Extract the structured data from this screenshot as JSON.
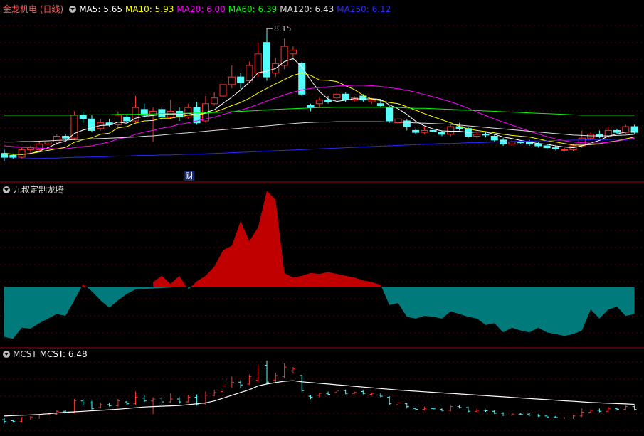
{
  "panel1": {
    "title": "金龙机电 (日线)",
    "ma_labels": [
      {
        "text": "MA5: 5.65",
        "color": "#ffffff"
      },
      {
        "text": "MA10: 5.93",
        "color": "#ffff00"
      },
      {
        "text": "MA20: 6.00",
        "color": "#ff00ff"
      },
      {
        "text": "MA60: 6.39",
        "color": "#00ff00"
      },
      {
        "text": "MA120: 6.43",
        "color": "#dddddd"
      },
      {
        "text": "MA250: 6.12",
        "color": "#2a2aff"
      }
    ],
    "high_label": "8.15",
    "event_badge": "财"
  },
  "panel2": {
    "title": "九叔定制龙腾"
  },
  "panel3": {
    "title": "MCST",
    "value_label": "MCST: 6.48"
  },
  "colors": {
    "up": "#ff3030",
    "down": "#54ffff",
    "grid": "#5a0000",
    "separator": "#a00000",
    "pos_area": "#c00000",
    "neg_area": "#007a7a",
    "mcst": "#ffffff"
  },
  "chart_data": [
    {
      "type": "candlestick",
      "panel": "price",
      "ylim": [
        4.4,
        8.6
      ],
      "candles": [
        [
          5.0,
          4.9,
          5.1,
          4.8
        ],
        [
          4.95,
          4.9,
          5.0,
          4.85
        ],
        [
          4.9,
          5.1,
          5.15,
          4.85
        ],
        [
          5.1,
          5.15,
          5.2,
          5.0
        ],
        [
          5.1,
          5.25,
          5.3,
          5.05
        ],
        [
          5.25,
          5.3,
          5.4,
          5.2
        ],
        [
          5.3,
          5.45,
          5.5,
          5.25
        ],
        [
          5.45,
          5.4,
          5.5,
          5.35
        ],
        [
          5.4,
          6.0,
          6.1,
          5.35
        ],
        [
          6.0,
          5.9,
          6.1,
          5.8
        ],
        [
          5.9,
          5.6,
          6.0,
          5.55
        ],
        [
          5.65,
          5.8,
          5.9,
          5.6
        ],
        [
          5.8,
          5.75,
          5.9,
          5.7
        ],
        [
          5.75,
          6.0,
          6.1,
          5.7
        ],
        [
          5.95,
          5.85,
          6.0,
          5.8
        ],
        [
          5.85,
          6.2,
          6.5,
          5.8
        ],
        [
          6.15,
          6.0,
          6.3,
          5.95
        ],
        [
          6.0,
          6.1,
          6.2,
          5.3
        ],
        [
          6.15,
          5.95,
          6.2,
          5.8
        ],
        [
          5.95,
          6.1,
          6.4,
          5.9
        ],
        [
          6.1,
          5.95,
          6.2,
          5.85
        ],
        [
          5.95,
          6.2,
          6.3,
          5.9
        ],
        [
          6.2,
          5.8,
          6.35,
          5.75
        ],
        [
          5.85,
          6.3,
          6.5,
          5.8
        ],
        [
          6.3,
          6.45,
          6.6,
          6.25
        ],
        [
          6.5,
          6.8,
          7.2,
          6.45
        ],
        [
          6.8,
          7.0,
          7.3,
          6.7
        ],
        [
          7.0,
          6.85,
          7.1,
          6.7
        ],
        [
          6.9,
          7.3,
          7.4,
          6.85
        ],
        [
          7.1,
          7.6,
          7.9,
          7.0
        ],
        [
          7.9,
          7.0,
          8.15,
          6.9
        ],
        [
          7.1,
          7.35,
          7.5,
          7.0
        ],
        [
          7.3,
          7.8,
          8.0,
          7.2
        ],
        [
          7.6,
          7.7,
          7.8,
          7.45
        ],
        [
          7.35,
          6.55,
          7.4,
          6.5
        ],
        [
          6.25,
          6.2,
          6.3,
          6.1
        ],
        [
          6.3,
          6.4,
          6.45,
          6.2
        ],
        [
          6.4,
          6.35,
          6.5,
          6.3
        ],
        [
          6.45,
          6.55,
          6.7,
          6.4
        ],
        [
          6.55,
          6.4,
          6.6,
          6.35
        ],
        [
          6.4,
          6.45,
          6.5,
          6.35
        ],
        [
          6.5,
          6.4,
          6.55,
          6.35
        ],
        [
          6.35,
          6.4,
          6.45,
          6.3
        ],
        [
          6.3,
          6.25,
          6.4,
          6.2
        ],
        [
          6.2,
          5.85,
          6.25,
          5.8
        ],
        [
          5.8,
          5.9,
          5.95,
          5.75
        ],
        [
          5.85,
          5.7,
          5.9,
          5.6
        ],
        [
          5.6,
          5.55,
          5.65,
          5.5
        ],
        [
          5.55,
          5.6,
          5.7,
          5.5
        ],
        [
          5.6,
          5.58,
          5.65,
          5.55
        ],
        [
          5.55,
          5.5,
          5.6,
          5.45
        ],
        [
          5.5,
          5.7,
          5.75,
          5.45
        ],
        [
          5.7,
          5.65,
          5.8,
          5.6
        ],
        [
          5.65,
          5.45,
          5.7,
          5.4
        ],
        [
          5.45,
          5.5,
          5.6,
          5.4
        ],
        [
          5.5,
          5.48,
          5.55,
          5.42
        ],
        [
          5.45,
          5.35,
          5.5,
          5.3
        ],
        [
          5.35,
          5.25,
          5.4,
          5.2
        ],
        [
          5.25,
          5.3,
          5.35,
          5.2
        ],
        [
          5.3,
          5.28,
          5.35,
          5.25
        ],
        [
          5.3,
          5.25,
          5.35,
          5.2
        ],
        [
          5.25,
          5.2,
          5.3,
          5.15
        ],
        [
          5.2,
          5.15,
          5.25,
          5.1
        ],
        [
          5.15,
          5.12,
          5.2,
          5.08
        ],
        [
          5.1,
          5.1,
          5.15,
          5.05
        ],
        [
          5.1,
          5.2,
          5.25,
          5.05
        ],
        [
          5.2,
          5.4,
          5.6,
          5.15
        ],
        [
          5.4,
          5.5,
          5.55,
          5.35
        ],
        [
          5.5,
          5.45,
          5.6,
          5.4
        ],
        [
          5.45,
          5.6,
          5.7,
          5.4
        ],
        [
          5.6,
          5.55,
          5.65,
          5.5
        ],
        [
          5.55,
          5.7,
          5.75,
          5.5
        ],
        [
          5.7,
          5.55,
          5.75,
          5.5
        ]
      ],
      "ma": {
        "MA5": [
          5.0,
          4.98,
          4.97,
          5.0,
          5.06,
          5.15,
          5.26,
          5.32,
          5.52,
          5.61,
          5.67,
          5.73,
          5.74,
          5.82,
          5.79,
          5.92,
          5.97,
          5.99,
          6.02,
          6.02,
          6.02,
          6.05,
          6.0,
          6.07,
          6.14,
          6.31,
          6.47,
          6.66,
          6.86,
          7.11,
          7.15,
          7.22,
          7.4,
          7.48,
          7.27,
          6.92,
          6.62,
          6.42,
          6.36,
          6.39,
          6.43,
          6.42,
          6.43,
          6.41,
          6.27,
          6.17,
          6.02,
          5.84,
          5.72,
          5.64,
          5.59,
          5.58,
          5.58,
          5.55,
          5.56,
          5.56,
          5.5,
          5.43,
          5.39,
          5.34,
          5.3,
          5.26,
          5.24,
          5.2,
          5.17,
          5.15,
          5.2,
          5.27,
          5.34,
          5.45,
          5.51,
          5.56,
          5.57
        ],
        "MA10": [
          5.0,
          4.98,
          4.97,
          5.0,
          5.04,
          5.08,
          5.12,
          5.16,
          5.29,
          5.36,
          5.41,
          5.5,
          5.53,
          5.67,
          5.7,
          5.79,
          5.85,
          5.86,
          5.92,
          5.92,
          5.96,
          6.0,
          6.0,
          6.05,
          6.08,
          6.16,
          6.25,
          6.33,
          6.44,
          6.58,
          6.7,
          6.82,
          6.93,
          7.04,
          7.1,
          7.04,
          6.92,
          6.91,
          6.88,
          6.77,
          6.67,
          6.52,
          6.42,
          6.38,
          6.33,
          6.3,
          6.22,
          6.13,
          6.04,
          5.96,
          5.88,
          5.8,
          5.71,
          5.64,
          5.6,
          5.57,
          5.54,
          5.5,
          5.47,
          5.45,
          5.43,
          5.38,
          5.33,
          5.3,
          5.26,
          5.22,
          5.22,
          5.23,
          5.25,
          5.3,
          5.33,
          5.38,
          5.43
        ],
        "MA20": [
          5.2,
          5.18,
          5.16,
          5.15,
          5.14,
          5.13,
          5.12,
          5.12,
          5.15,
          5.18,
          5.2,
          5.25,
          5.3,
          5.38,
          5.42,
          5.5,
          5.56,
          5.6,
          5.66,
          5.7,
          5.76,
          5.8,
          5.85,
          5.9,
          5.95,
          6.02,
          6.08,
          6.13,
          6.2,
          6.28,
          6.37,
          6.45,
          6.53,
          6.6,
          6.66,
          6.7,
          6.72,
          6.74,
          6.76,
          6.77,
          6.78,
          6.78,
          6.77,
          6.75,
          6.72,
          6.69,
          6.65,
          6.6,
          6.54,
          6.48,
          6.42,
          6.35,
          6.27,
          6.18,
          6.08,
          5.99,
          5.9,
          5.82,
          5.74,
          5.66,
          5.58,
          5.51,
          5.44,
          5.38,
          5.33,
          5.3,
          5.28,
          5.27,
          5.27,
          5.29,
          5.32,
          5.36,
          5.4
        ],
        "MA60": [
          6.0,
          6.0,
          6.0,
          6.0,
          6.0,
          6.0,
          6.0,
          6.0,
          6.0,
          6.01,
          6.01,
          6.01,
          6.01,
          6.02,
          6.02,
          6.02,
          6.03,
          6.03,
          6.04,
          6.04,
          6.05,
          6.05,
          6.06,
          6.06,
          6.07,
          6.08,
          6.09,
          6.1,
          6.11,
          6.12,
          6.14,
          6.15,
          6.16,
          6.17,
          6.18,
          6.19,
          6.2,
          6.2,
          6.21,
          6.21,
          6.21,
          6.21,
          6.21,
          6.21,
          6.2,
          6.2,
          6.19,
          6.18,
          6.18,
          6.17,
          6.16,
          6.15,
          6.14,
          6.13,
          6.12,
          6.11,
          6.1,
          6.09,
          6.08,
          6.07,
          6.06,
          6.05,
          6.04,
          6.03,
          6.02,
          6.01,
          6.0,
          6.0,
          6.0,
          6.0,
          6.0,
          6.0,
          6.0
        ],
        "MA120": [
          5.3,
          5.3,
          5.31,
          5.31,
          5.32,
          5.33,
          5.34,
          5.35,
          5.36,
          5.37,
          5.38,
          5.39,
          5.4,
          5.41,
          5.42,
          5.43,
          5.45,
          5.46,
          5.48,
          5.5,
          5.52,
          5.54,
          5.56,
          5.58,
          5.6,
          5.62,
          5.64,
          5.66,
          5.68,
          5.7,
          5.72,
          5.74,
          5.76,
          5.78,
          5.8,
          5.81,
          5.82,
          5.82,
          5.83,
          5.83,
          5.83,
          5.83,
          5.83,
          5.83,
          5.82,
          5.82,
          5.81,
          5.8,
          5.79,
          5.78,
          5.77,
          5.76,
          5.74,
          5.72,
          5.7,
          5.68,
          5.66,
          5.64,
          5.62,
          5.6,
          5.58,
          5.56,
          5.54,
          5.52,
          5.5,
          5.48,
          5.47,
          5.46,
          5.46,
          5.46,
          5.47,
          5.48,
          5.5
        ],
        "MA250": [
          4.85,
          4.86,
          4.86,
          4.87,
          4.87,
          4.88,
          4.88,
          4.89,
          4.9,
          4.9,
          4.91,
          4.91,
          4.92,
          4.93,
          4.93,
          4.94,
          4.95,
          4.95,
          4.96,
          4.96,
          4.97,
          4.98,
          4.98,
          4.99,
          5.0,
          5.01,
          5.02,
          5.03,
          5.04,
          5.05,
          5.06,
          5.07,
          5.08,
          5.09,
          5.1,
          5.11,
          5.12,
          5.13,
          5.14,
          5.15,
          5.16,
          5.17,
          5.18,
          5.19,
          5.2,
          5.21,
          5.22,
          5.23,
          5.24,
          5.25,
          5.26,
          5.26,
          5.27,
          5.28,
          5.28,
          5.29,
          5.3,
          5.3,
          5.31,
          5.32,
          5.32,
          5.33,
          5.33,
          5.34,
          5.34,
          5.35,
          5.35,
          5.36,
          5.36,
          5.36,
          5.37,
          5.37,
          5.37
        ]
      }
    },
    {
      "type": "area",
      "panel": "indicator",
      "ylim": [
        -60,
        110
      ],
      "baseline": 0,
      "values": [
        -55,
        -57,
        -45,
        -46,
        -40,
        -35,
        -30,
        -32,
        -15,
        3,
        -5,
        -15,
        -23,
        -15,
        -8,
        -3,
        0,
        5,
        12,
        3,
        12,
        -3,
        6,
        12,
        22,
        40,
        45,
        72,
        50,
        65,
        105,
        95,
        15,
        10,
        12,
        15,
        14,
        16,
        14,
        12,
        10,
        7,
        5,
        2,
        -20,
        -18,
        -33,
        -35,
        -32,
        -33,
        -35,
        -27,
        -30,
        -33,
        -35,
        -42,
        -40,
        -50,
        -45,
        -48,
        -50,
        -45,
        -50,
        -52,
        -54,
        -52,
        -48,
        -25,
        -35,
        -25,
        -22,
        -32,
        -30
      ]
    },
    {
      "type": "candlestick",
      "panel": "mcst",
      "ylim": [
        4.4,
        8.6
      ],
      "mcst": [
        5.2,
        5.22,
        5.24,
        5.26,
        5.28,
        5.32,
        5.36,
        5.4,
        5.42,
        5.45,
        5.48,
        5.5,
        5.53,
        5.56,
        5.6,
        5.64,
        5.68,
        5.7,
        5.72,
        5.74,
        5.76,
        5.8,
        5.85,
        5.9,
        6.0,
        6.15,
        6.3,
        6.45,
        6.6,
        6.8,
        6.9,
        6.98,
        7.05,
        7.08,
        7.02,
        6.98,
        6.94,
        6.9,
        6.86,
        6.82,
        6.78,
        6.74,
        6.7,
        6.66,
        6.62,
        6.58,
        6.55,
        6.52,
        6.49,
        6.46,
        6.43,
        6.4,
        6.37,
        6.34,
        6.31,
        6.28,
        6.25,
        6.22,
        6.19,
        6.16,
        6.13,
        6.1,
        6.07,
        6.04,
        6.01,
        5.98,
        5.95,
        5.92,
        5.9,
        5.88,
        5.86,
        5.84,
        5.82
      ]
    }
  ]
}
